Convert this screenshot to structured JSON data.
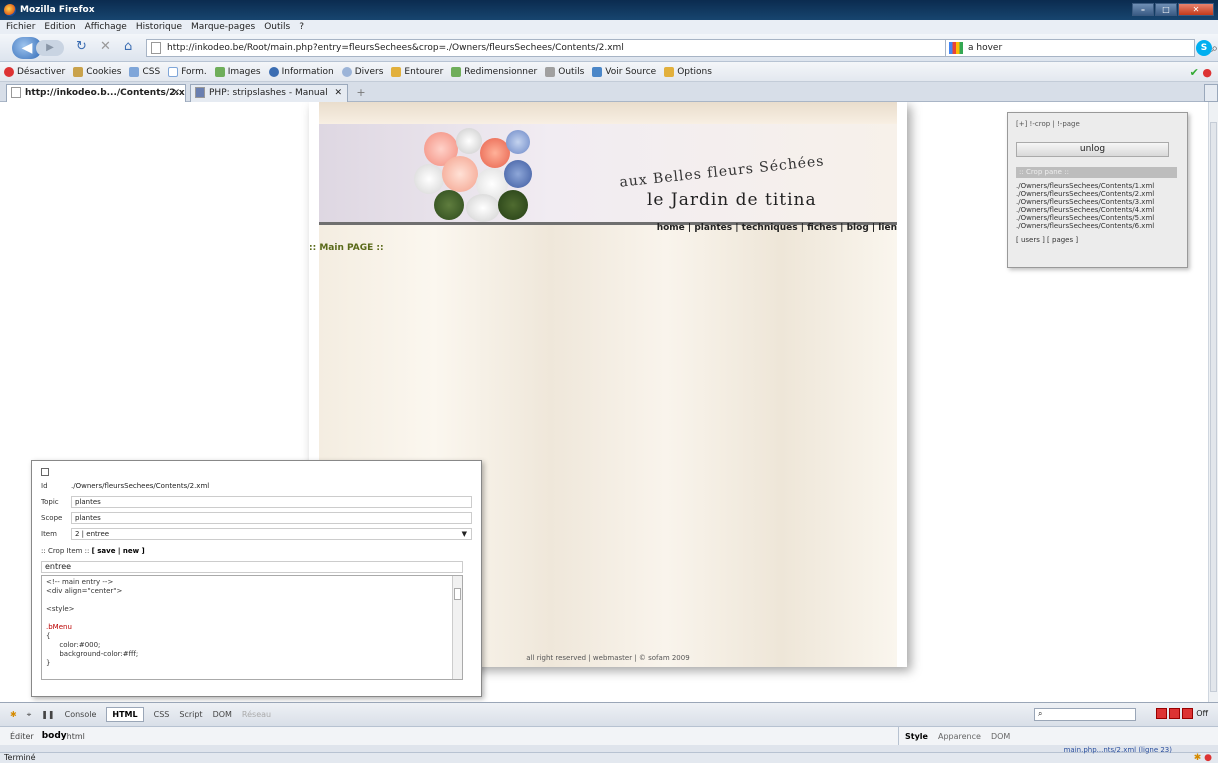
{
  "window": {
    "title": "Mozilla Firefox"
  },
  "menu": [
    "Fichier",
    "Edition",
    "Affichage",
    "Historique",
    "Marque-pages",
    "Outils",
    "?"
  ],
  "nav": {
    "url": "http://inkodeo.be/Root/main.php?entry=fleursSechees&crop=./Owners/fleursSechees/Contents/2.xml",
    "search": "a hover"
  },
  "devbar": [
    "Désactiver",
    "Cookies",
    "CSS",
    "Form.",
    "Images",
    "Information",
    "Divers",
    "Entourer",
    "Redimensionner",
    "Outils",
    "Voir Source",
    "Options"
  ],
  "tabs": [
    {
      "label": "http://inkodeo.b.../Contents/2.xml"
    },
    {
      "label": "PHP: stripslashes - Manual"
    }
  ],
  "site": {
    "title_top": "aux Belles fleurs Séchées",
    "title_main": "le Jardin de titina",
    "nav_links": "home | plantes | techniques | fiches | blog | lien",
    "main_label": ":: Main PAGE ::",
    "footer": "all right reserved | webmaster | © sofam 2009"
  },
  "crop_panel": {
    "top_links": "[+] !-crop | !-page",
    "unlog": "unlog",
    "crop_header": ":: Crop pane ::",
    "files": [
      "./Owners/fleursSechees/Contents/1.xml",
      "./Owners/fleursSechees/Contents/2.xml",
      "./Owners/fleursSechees/Contents/3.xml",
      "./Owners/fleursSechees/Contents/4.xml",
      "./Owners/fleursSechees/Contents/5.xml",
      "./Owners/fleursSechees/Contents/6.xml"
    ],
    "bottom_links": "[ users ] [ pages ]"
  },
  "editor": {
    "id_label": "Id",
    "id_value": "./Owners/fleursSechees/Contents/2.xml",
    "topic_label": "Topic",
    "topic_value": "plantes",
    "scope_label": "Scope",
    "scope_value": "plantes",
    "item_label": "Item",
    "item_value": "2 | entree",
    "crop_item_prefix": ":: Crop Item :: ",
    "crop_item_actions": "[ save | new ]",
    "entree": "entree",
    "code": [
      "<!-- main entry -->",
      "<div align=\"center\">",
      "",
      "<style>",
      "",
      ".bMenu",
      "{",
      "      color:#000;",
      "      background-color:#fff;",
      "}"
    ]
  },
  "firebug": {
    "tabs": [
      "Console",
      "HTML",
      "CSS",
      "Script",
      "DOM",
      "Réseau"
    ],
    "breadcrumb": [
      "Éditer",
      "body",
      "html"
    ],
    "side_tabs": [
      "Style",
      "Apparence",
      "DOM"
    ],
    "off": "Off",
    "status_right": "main.php...nts/2.xml (ligne 23)"
  },
  "status": {
    "text": "Terminé"
  },
  "colors": {
    "accent": "#2f68b5",
    "nav_green": "#5a6a1a"
  }
}
